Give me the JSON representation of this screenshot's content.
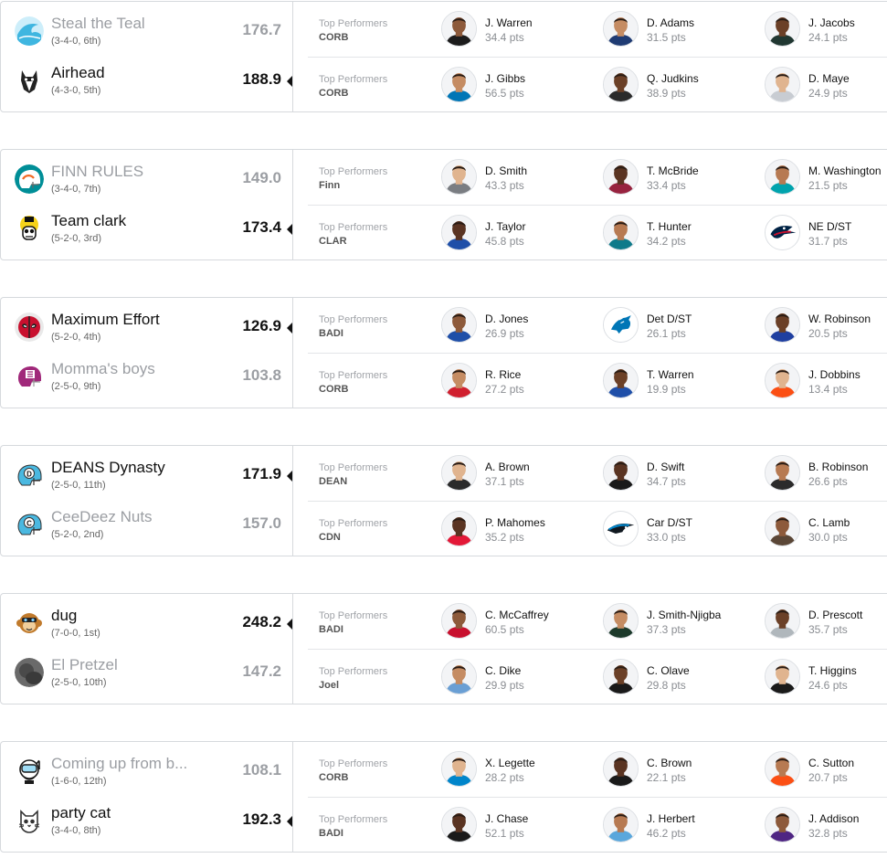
{
  "labels": {
    "top_performers": "Top Performers"
  },
  "matchups": [
    {
      "teams": [
        {
          "name": "Steal the Teal",
          "record": "(3-4-0, 6th)",
          "score": "176.7",
          "winner": false,
          "logo": "teal-wave-icon",
          "logo_color": "#3fb6e0"
        },
        {
          "name": "Airhead",
          "record": "(4-3-0, 5th)",
          "score": "188.9",
          "winner": true,
          "logo": "wolf-mascot-icon",
          "logo_color": "#222222"
        }
      ],
      "performers": [
        {
          "team_abbr": "CORB",
          "players": [
            {
              "name": "J. Warren",
              "pts": "34.4 pts",
              "jersey": "#1c1c1c",
              "kind": "player"
            },
            {
              "name": "D. Adams",
              "pts": "31.5 pts",
              "jersey": "#1f3b73",
              "kind": "player"
            },
            {
              "name": "J. Jacobs",
              "pts": "24.1 pts",
              "jersey": "#203731",
              "kind": "player"
            }
          ]
        },
        {
          "team_abbr": "CORB",
          "players": [
            {
              "name": "J. Gibbs",
              "pts": "56.5 pts",
              "jersey": "#0076b6",
              "kind": "player"
            },
            {
              "name": "Q. Judkins",
              "pts": "38.9 pts",
              "jersey": "#2b2b2b",
              "kind": "player"
            },
            {
              "name": "D. Maye",
              "pts": "24.9 pts",
              "jersey": "#c8ccd2",
              "kind": "player"
            }
          ]
        }
      ]
    },
    {
      "teams": [
        {
          "name": "FINN RULES",
          "record": "(3-4-0, 7th)",
          "score": "149.0",
          "winner": false,
          "logo": "dolphins-helmet-icon",
          "logo_color": "#008e97"
        },
        {
          "name": "Team clark",
          "record": "(5-2-0, 3rd)",
          "score": "173.4",
          "winner": true,
          "logo": "skull-mascot-icon",
          "logo_color": "#111111"
        }
      ],
      "performers": [
        {
          "team_abbr": "Finn",
          "players": [
            {
              "name": "D. Smith",
              "pts": "43.3 pts",
              "jersey": "#7a7d82",
              "kind": "player"
            },
            {
              "name": "T. McBride",
              "pts": "33.4 pts",
              "jersey": "#97233f",
              "kind": "player"
            },
            {
              "name": "M. Washington",
              "pts": "21.5 pts",
              "jersey": "#00a3ad",
              "kind": "player"
            }
          ]
        },
        {
          "team_abbr": "CLAR",
          "players": [
            {
              "name": "J. Taylor",
              "pts": "45.8 pts",
              "jersey": "#1f4fa8",
              "kind": "player"
            },
            {
              "name": "T. Hunter",
              "pts": "34.2 pts",
              "jersey": "#0f7a8a",
              "kind": "player"
            },
            {
              "name": "NE D/ST",
              "pts": "31.7 pts",
              "jersey": "#002244",
              "kind": "defense"
            }
          ]
        }
      ]
    },
    {
      "teams": [
        {
          "name": "Maximum Effort",
          "record": "(5-2-0, 4th)",
          "score": "126.9",
          "winner": true,
          "logo": "deadpool-mask-icon",
          "logo_color": "#c8102e"
        },
        {
          "name": "Momma's boys",
          "record": "(2-5-0, 9th)",
          "score": "103.8",
          "winner": false,
          "logo": "purple-helmet-icon",
          "logo_color": "#a0287a"
        }
      ],
      "performers": [
        {
          "team_abbr": "BADI",
          "players": [
            {
              "name": "D. Jones",
              "pts": "26.9 pts",
              "jersey": "#1f4fa8",
              "kind": "player"
            },
            {
              "name": "Det D/ST",
              "pts": "26.1 pts",
              "jersey": "#0076b6",
              "kind": "defense"
            },
            {
              "name": "W. Robinson",
              "pts": "20.5 pts",
              "jersey": "#1f3fa0",
              "kind": "player"
            }
          ]
        },
        {
          "team_abbr": "CORB",
          "players": [
            {
              "name": "R. Rice",
              "pts": "27.2 pts",
              "jersey": "#d0202f",
              "kind": "player"
            },
            {
              "name": "T. Warren",
              "pts": "19.9 pts",
              "jersey": "#1f4fa8",
              "kind": "player"
            },
            {
              "name": "J. Dobbins",
              "pts": "13.4 pts",
              "jersey": "#fb4f14",
              "kind": "player"
            }
          ]
        }
      ]
    },
    {
      "teams": [
        {
          "name": "DEANS Dynasty",
          "record": "(2-5-0, 11th)",
          "score": "171.9",
          "winner": true,
          "logo": "d-helmet-icon",
          "logo_color": "#4ab8e0"
        },
        {
          "name": "CeeDeez Nuts",
          "record": "(5-2-0, 2nd)",
          "score": "157.0",
          "winner": false,
          "logo": "c-helmet-icon",
          "logo_color": "#4ab8e0"
        }
      ],
      "performers": [
        {
          "team_abbr": "DEAN",
          "players": [
            {
              "name": "A. Brown",
              "pts": "37.1 pts",
              "jersey": "#2b2b2b",
              "kind": "player"
            },
            {
              "name": "D. Swift",
              "pts": "34.7 pts",
              "jersey": "#1a1a1a",
              "kind": "player"
            },
            {
              "name": "B. Robinson",
              "pts": "26.6 pts",
              "jersey": "#2b2b2b",
              "kind": "player"
            }
          ]
        },
        {
          "team_abbr": "CDN",
          "players": [
            {
              "name": "P. Mahomes",
              "pts": "35.2 pts",
              "jersey": "#e31837",
              "kind": "player"
            },
            {
              "name": "Car D/ST",
              "pts": "33.0 pts",
              "jersey": "#0085ca",
              "kind": "defense"
            },
            {
              "name": "C. Lamb",
              "pts": "30.0 pts",
              "jersey": "#5a4636",
              "kind": "player"
            }
          ]
        }
      ]
    },
    {
      "teams": [
        {
          "name": "dug",
          "record": "(7-0-0, 1st)",
          "score": "248.2",
          "winner": true,
          "logo": "monkey-mascot-icon",
          "logo_color": "#c07a2c"
        },
        {
          "name": "El Pretzel",
          "record": "(2-5-0, 10th)",
          "score": "147.2",
          "winner": false,
          "logo": "pretzel-photo-icon",
          "logo_color": "#4a4a4a"
        }
      ],
      "performers": [
        {
          "team_abbr": "BADI",
          "players": [
            {
              "name": "C. McCaffrey",
              "pts": "60.5 pts",
              "jersey": "#c8102e",
              "kind": "player"
            },
            {
              "name": "J. Smith-Njigba",
              "pts": "37.3 pts",
              "jersey": "#1d3a2b",
              "kind": "player"
            },
            {
              "name": "D. Prescott",
              "pts": "35.7 pts",
              "jersey": "#b0b7bc",
              "kind": "player"
            }
          ]
        },
        {
          "team_abbr": "Joel",
          "players": [
            {
              "name": "C. Dike",
              "pts": "29.9 pts",
              "jersey": "#6a9fd4",
              "kind": "player"
            },
            {
              "name": "C. Olave",
              "pts": "29.8 pts",
              "jersey": "#1a1a1a",
              "kind": "player"
            },
            {
              "name": "T. Higgins",
              "pts": "24.6 pts",
              "jersey": "#1a1a1a",
              "kind": "player"
            }
          ]
        }
      ]
    },
    {
      "teams": [
        {
          "name": "Coming up from b...",
          "record": "(1-6-0, 12th)",
          "score": "108.1",
          "winner": false,
          "logo": "diver-mascot-icon",
          "logo_color": "#1a1a1a"
        },
        {
          "name": "party cat",
          "record": "(3-4-0, 8th)",
          "score": "192.3",
          "winner": true,
          "logo": "cat-mascot-icon",
          "logo_color": "#333333"
        }
      ],
      "performers": [
        {
          "team_abbr": "CORB",
          "players": [
            {
              "name": "X. Legette",
              "pts": "28.2 pts",
              "jersey": "#0085ca",
              "kind": "player"
            },
            {
              "name": "C. Brown",
              "pts": "22.1 pts",
              "jersey": "#1a1a1a",
              "kind": "player"
            },
            {
              "name": "C. Sutton",
              "pts": "20.7 pts",
              "jersey": "#fb4f14",
              "kind": "player"
            }
          ]
        },
        {
          "team_abbr": "BADI",
          "players": [
            {
              "name": "J. Chase",
              "pts": "52.1 pts",
              "jersey": "#1a1a1a",
              "kind": "player"
            },
            {
              "name": "J. Herbert",
              "pts": "46.2 pts",
              "jersey": "#5aa7dc",
              "kind": "player"
            },
            {
              "name": "J. Addison",
              "pts": "32.8 pts",
              "jersey": "#4f2683",
              "kind": "player"
            }
          ]
        }
      ]
    }
  ]
}
